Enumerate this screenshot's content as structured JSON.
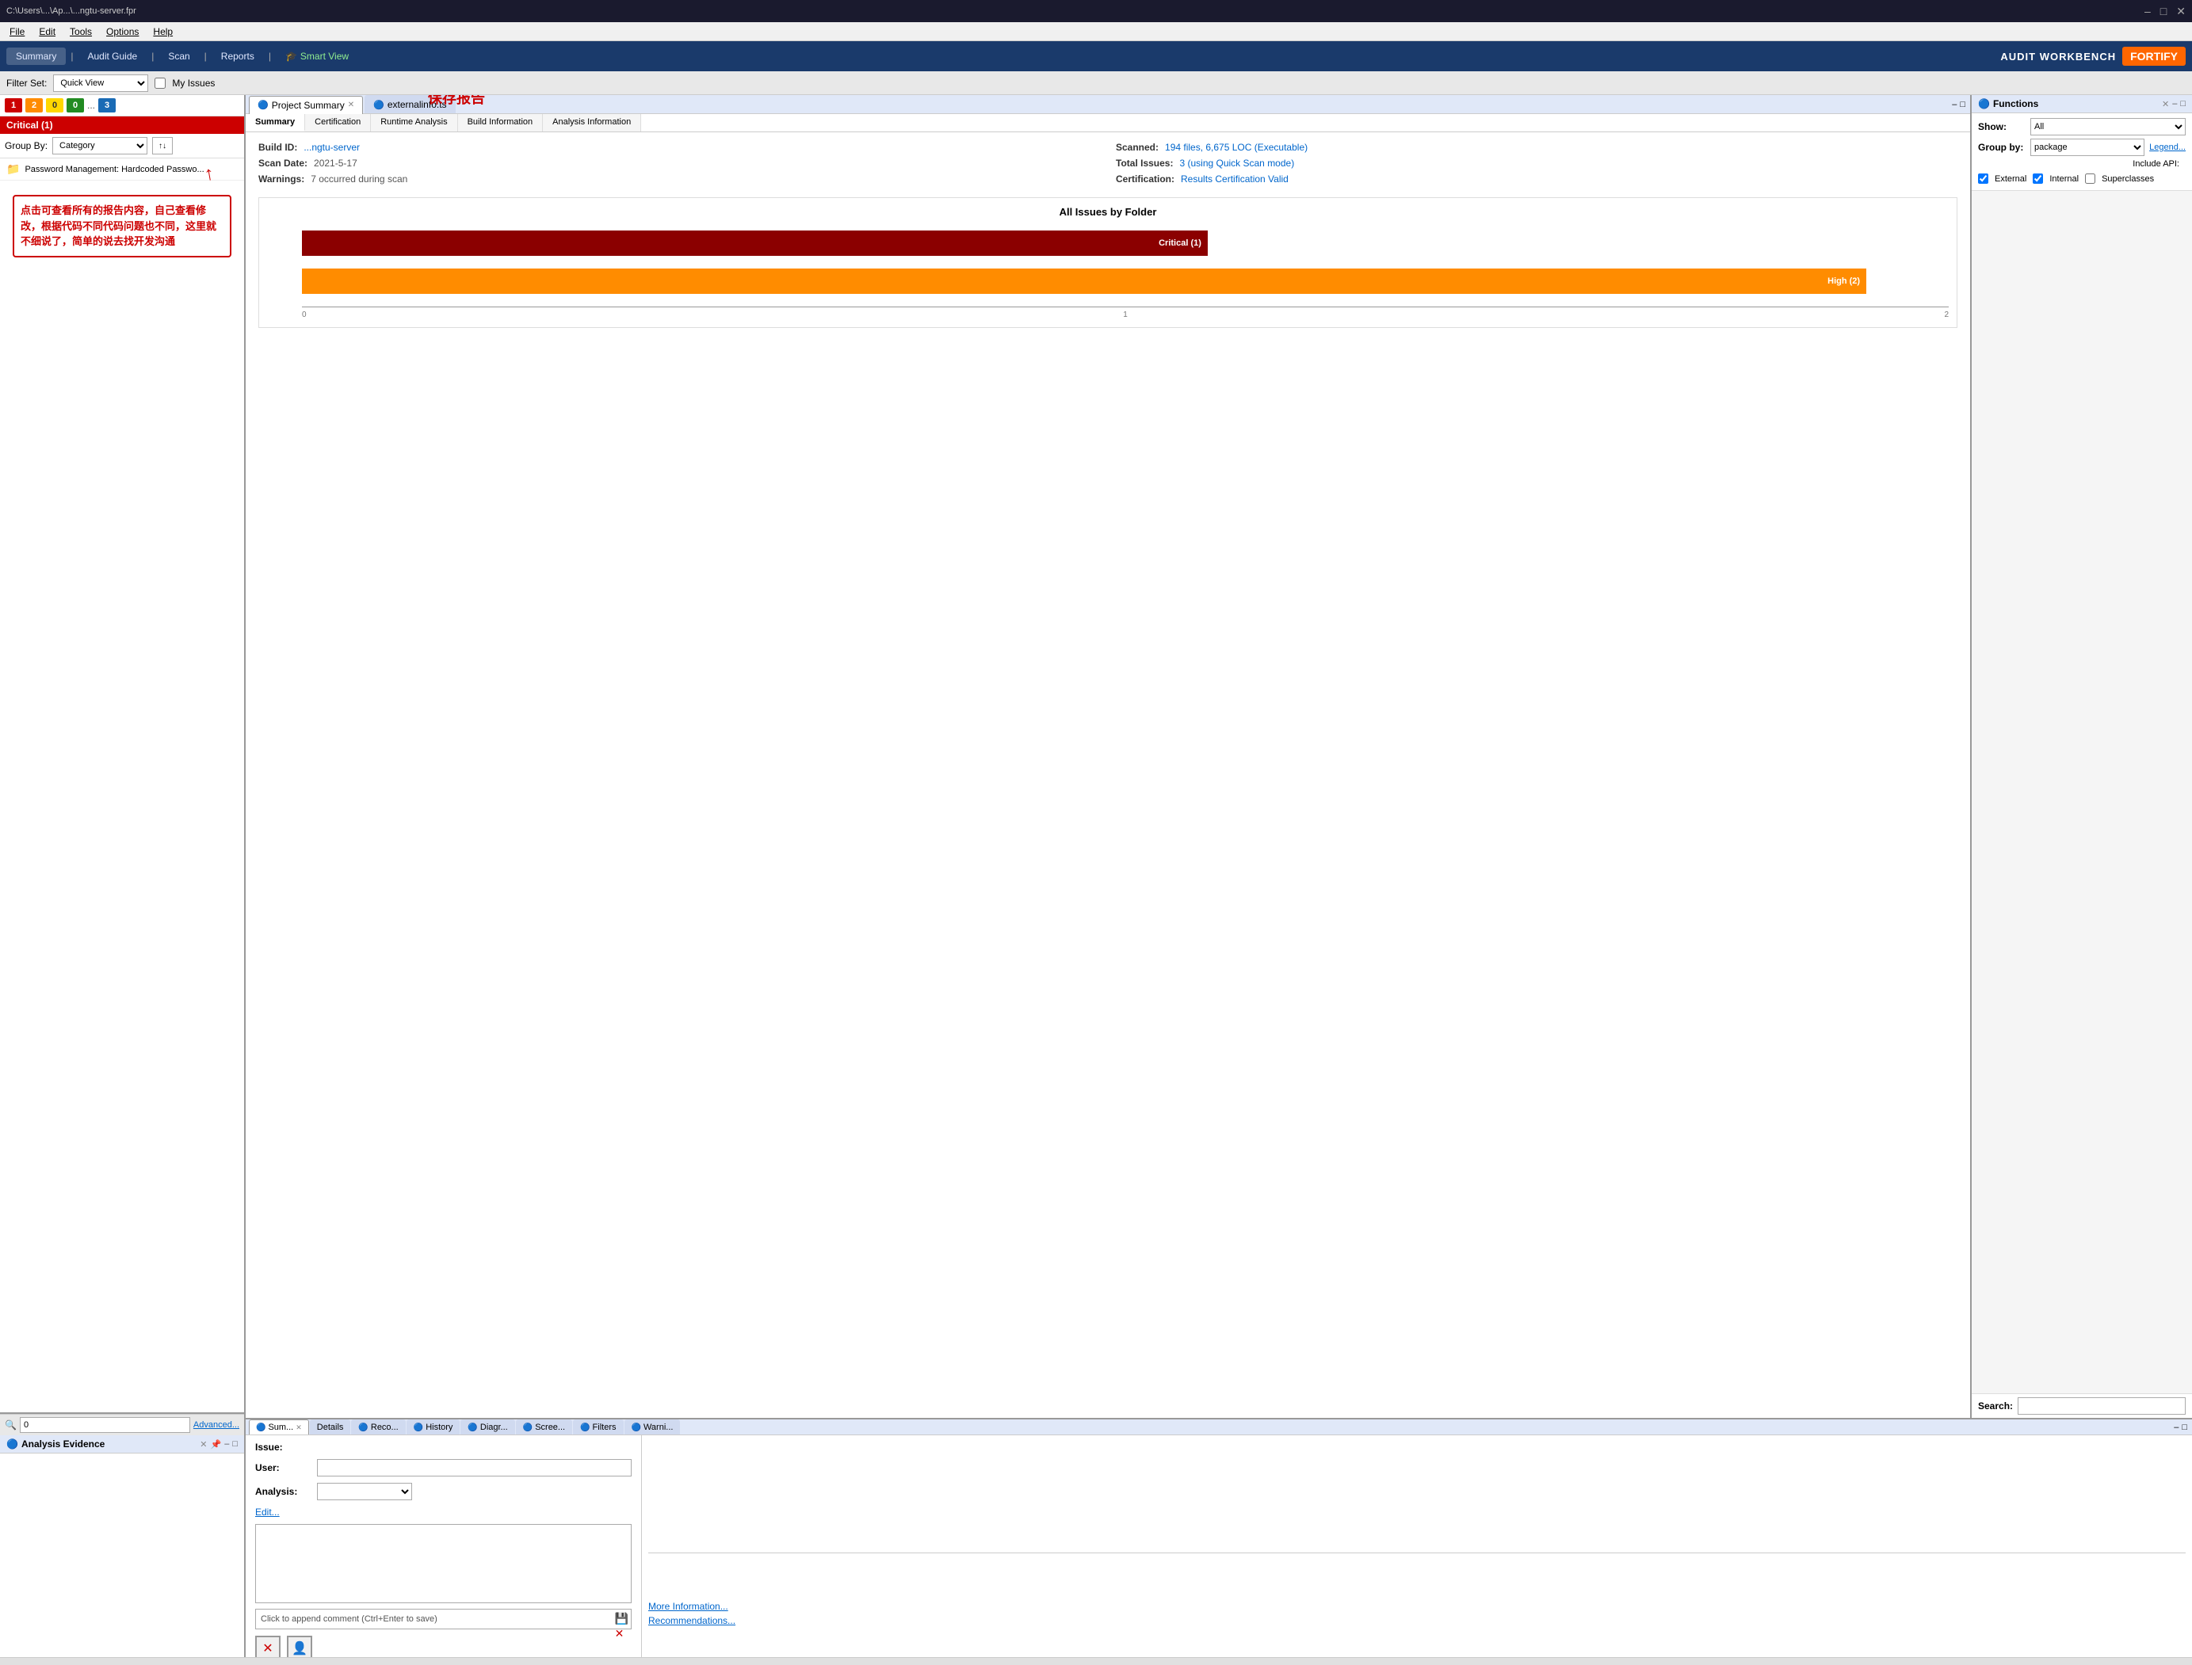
{
  "titlebar": {
    "path": "C:\\Users\\...\\Ap...\\...ngtu-server.fpr",
    "minimize": "–",
    "maximize": "□",
    "close": "✕"
  },
  "menubar": {
    "items": [
      "File",
      "Edit",
      "Tools",
      "Options",
      "Help"
    ]
  },
  "toolbar": {
    "items": [
      "Summary",
      "Audit Guide",
      "Scan",
      "Reports"
    ],
    "separator": "|",
    "smartview": "Smart View",
    "audit_workbench": "AUDIT WORKBENCH",
    "fortify": "FORTIFY"
  },
  "filterbar": {
    "label": "Filter Set:",
    "value": "Quick View",
    "checkbox_label": "My Issues"
  },
  "left_panel": {
    "counters": [
      {
        "value": "1",
        "type": "red"
      },
      {
        "value": "2",
        "type": "orange"
      },
      {
        "value": "0",
        "type": "yellow"
      },
      {
        "value": "0",
        "type": "green"
      },
      {
        "ellipsis": "..."
      },
      {
        "value": "3",
        "type": "blue"
      }
    ],
    "critical_header": "Critical (1)",
    "groupby_label": "Group By:",
    "groupby_value": "Category",
    "issue_item": "Password Management: Hardcoded Passwo...",
    "annotation_text": "点击可查看所有的报告内容，自己查看修改，根据代码不同代码问题也不同，这里就不细说了，简单的说去找开发沟通",
    "search_placeholder": "0",
    "advanced_link": "Advanced..."
  },
  "analysis_evidence": {
    "title": "Analysis Evidence",
    "panel_icon": "🔵"
  },
  "project_summary": {
    "tab_title": "Project Summary",
    "tab2_title": "externalinfo.ts",
    "subtabs": [
      "Summary",
      "Certification",
      "Runtime Analysis",
      "Build Information",
      "Analysis Information"
    ],
    "active_subtab": "Summary",
    "build_id_label": "Build ID:",
    "build_id_value": "...ngtu-server",
    "scan_date_label": "Scan Date:",
    "scan_date_value": "2021-5-17",
    "warnings_label": "Warnings:",
    "warnings_value": "7 occurred during scan",
    "scanned_label": "Scanned:",
    "scanned_value": "194 files, 6,675 LOC (Executable)",
    "total_issues_label": "Total Issues:",
    "total_issues_value": "3 (using Quick Scan mode)",
    "certification_label": "Certification:",
    "certification_value": "Results Certification Valid",
    "chart_title": "All Issues by Folder",
    "chart_bars": [
      {
        "label": "Critical (1)",
        "value": 1,
        "max": 2,
        "color": "#8b0000",
        "width_pct": 55
      },
      {
        "label": "High (2)",
        "value": 2,
        "max": 2,
        "color": "#ff8c00",
        "width_pct": 95
      }
    ]
  },
  "save_annotation": "保存报告",
  "functions": {
    "title": "Functions",
    "show_label": "Show:",
    "show_value": "All",
    "groupby_label": "Group by:",
    "groupby_value": "package",
    "legend_link": "Legend...",
    "include_api_label": "Include API:",
    "checkboxes": [
      {
        "label": "External",
        "checked": true
      },
      {
        "label": "Internal",
        "checked": true
      },
      {
        "label": "Superclasses",
        "checked": false
      }
    ],
    "search_label": "Search:"
  },
  "bottom_tabs": {
    "tabs": [
      {
        "label": "Sum...",
        "active": true,
        "icon": true
      },
      {
        "label": "Details",
        "active": false,
        "icon": false
      },
      {
        "label": "Reco...",
        "active": false,
        "icon": true
      },
      {
        "label": "History",
        "active": false,
        "icon": true
      },
      {
        "label": "Diagr...",
        "active": false,
        "icon": true
      },
      {
        "label": "Scree...",
        "active": false,
        "icon": true
      },
      {
        "label": "Filters",
        "active": false,
        "icon": true
      },
      {
        "label": "Warni...",
        "active": false,
        "icon": true
      }
    ]
  },
  "bottom_content": {
    "issue_label": "Issue:",
    "user_label": "User:",
    "analysis_label": "Analysis:",
    "edit_link": "Edit...",
    "comment_hint": "Click to append comment (Ctrl+Enter to save)",
    "more_info_link": "More Information...",
    "recommendations_link": "Recommendations..."
  }
}
